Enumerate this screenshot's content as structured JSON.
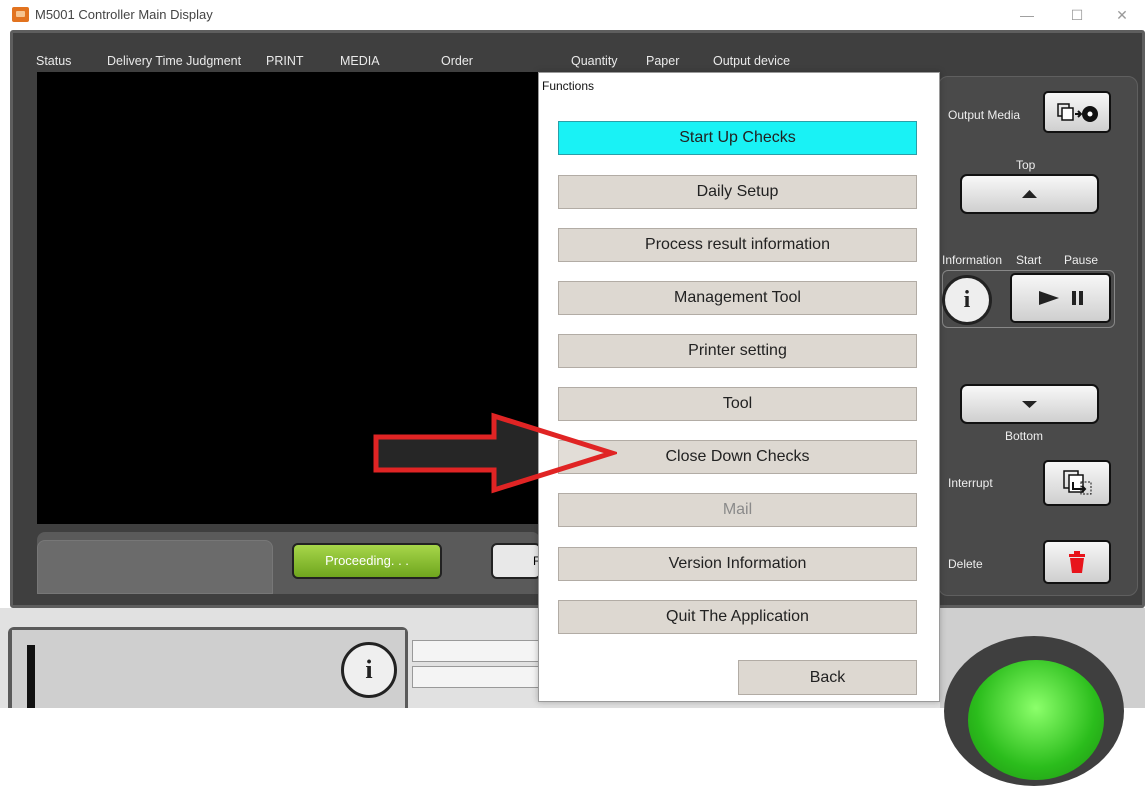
{
  "window": {
    "title": "M5001 Controller Main Display",
    "minimize": "—",
    "maximize": "☐",
    "close": "✕"
  },
  "header": {
    "columns": [
      "Status",
      "Delivery Time Judgment",
      "PRINT",
      "MEDIA",
      "Order",
      "Quantity",
      "Paper",
      "Output device"
    ]
  },
  "status_bar": {
    "proceeding_label": "Proceeding. . .",
    "partial_button_text": "F"
  },
  "right_panel": {
    "output_media_label": "Output Media",
    "top_label": "Top",
    "information_label": "Information",
    "start_label": "Start",
    "pause_label": "Pause",
    "bottom_label": "Bottom",
    "interrupt_label": "Interrupt",
    "delete_label": "Delete",
    "info_glyph": "i"
  },
  "bottom": {
    "info_glyph": "i"
  },
  "dialog": {
    "title": "Functions",
    "buttons": [
      {
        "label": "Start Up Checks",
        "state": "selected"
      },
      {
        "label": "Daily Setup",
        "state": "normal"
      },
      {
        "label": "Process result information",
        "state": "normal"
      },
      {
        "label": "Management Tool",
        "state": "normal"
      },
      {
        "label": "Printer setting",
        "state": "normal"
      },
      {
        "label": "Tool",
        "state": "normal"
      },
      {
        "label": "Close Down Checks",
        "state": "normal"
      },
      {
        "label": "Mail",
        "state": "disabled"
      },
      {
        "label": "Version Information",
        "state": "normal"
      },
      {
        "label": "Quit The Application",
        "state": "normal"
      }
    ],
    "back_label": "Back"
  },
  "annotation": {
    "arrow_color": "#e02424",
    "points_to": "Close Down Checks"
  },
  "colors": {
    "selected_button": "#19f2f5",
    "proceeding_green": "#8cc63f",
    "delete_red": "#e8141b"
  }
}
